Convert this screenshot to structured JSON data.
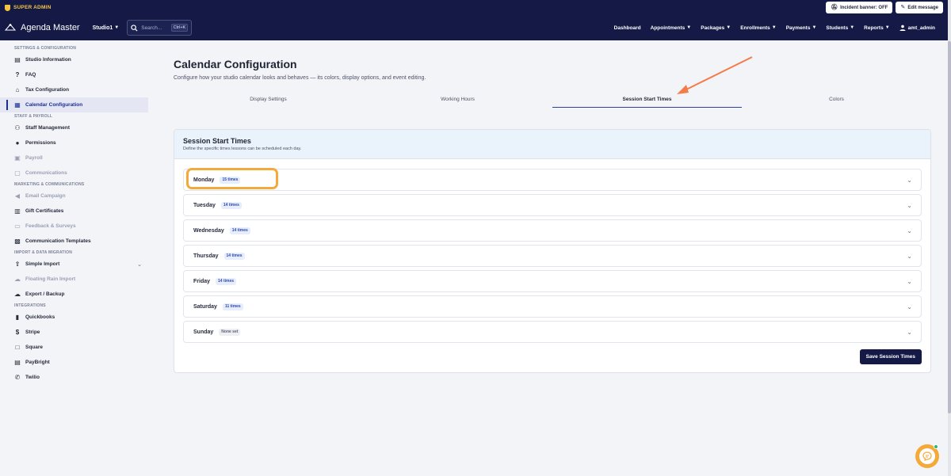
{
  "topbar": {
    "super_admin_label": "SUPER ADMIN",
    "incident_banner_label": "Incident banner: OFF",
    "edit_message_label": "Edit message"
  },
  "nav": {
    "brand": "Agenda Master",
    "studio": "Studio1",
    "search_placeholder": "Search...",
    "search_shortcut": "Ctrl+K",
    "menu": [
      {
        "label": "Dashboard",
        "has_caret": false
      },
      {
        "label": "Appointments",
        "has_caret": true
      },
      {
        "label": "Packages",
        "has_caret": true
      },
      {
        "label": "Enrollments",
        "has_caret": true
      },
      {
        "label": "Payments",
        "has_caret": true
      },
      {
        "label": "Students",
        "has_caret": true
      },
      {
        "label": "Reports",
        "has_caret": true
      }
    ],
    "user": "amt_admin"
  },
  "sidebar": {
    "sections": [
      {
        "title": "SETTINGS & CONFIGURATION",
        "items": [
          {
            "label": "Studio Information",
            "icon": "id-card-icon"
          },
          {
            "label": "FAQ",
            "icon": "help-circle-icon"
          },
          {
            "label": "Tax Configuration",
            "icon": "bank-icon"
          },
          {
            "label": "Calendar Configuration",
            "icon": "calendar-icon",
            "active": true
          }
        ]
      },
      {
        "title": "STAFF & PAYROLL",
        "items": [
          {
            "label": "Staff Management",
            "icon": "users-icon"
          },
          {
            "label": "Permissions",
            "icon": "user-shield-icon"
          },
          {
            "label": "Payroll",
            "icon": "money-icon",
            "muted": true
          },
          {
            "label": "Communications",
            "icon": "chat-icon",
            "muted": true
          }
        ]
      },
      {
        "title": "MARKETING & COMMUNICATIONS",
        "items": [
          {
            "label": "Email Campaign",
            "icon": "megaphone-icon",
            "muted": true
          },
          {
            "label": "Gift Certificates",
            "icon": "gift-icon"
          },
          {
            "label": "Feedback & Surveys",
            "icon": "feedback-icon",
            "muted": true
          },
          {
            "label": "Communication Templates",
            "icon": "templates-icon"
          }
        ]
      },
      {
        "title": "IMPORT & DATA MIGRATION",
        "items": [
          {
            "label": "Simple Import",
            "icon": "upload-icon",
            "chevron": true
          },
          {
            "label": "Floating Rain Import",
            "icon": "cloud-upload-icon",
            "muted": true
          },
          {
            "label": "Export / Backup",
            "icon": "cloud-download-icon"
          }
        ]
      },
      {
        "title": "INTEGRATIONS",
        "items": [
          {
            "label": "Quickbooks",
            "icon": "document-icon"
          },
          {
            "label": "Stripe",
            "icon": "stripe-icon"
          },
          {
            "label": "Square",
            "icon": "square-icon"
          },
          {
            "label": "PayBright",
            "icon": "printer-icon"
          },
          {
            "label": "Twilio",
            "icon": "phone-icon"
          }
        ]
      }
    ]
  },
  "main": {
    "title": "Calendar Configuration",
    "subtitle": "Configure how your studio calendar looks and behaves — its colors, display options, and event editing.",
    "tabs": [
      {
        "label": "Display Settings",
        "active": false
      },
      {
        "label": "Working Hours",
        "active": false
      },
      {
        "label": "Session Start Times",
        "active": true
      },
      {
        "label": "Colors",
        "active": false
      }
    ],
    "panel": {
      "title": "Session Start Times",
      "description": "Define the specific times lessons can be scheduled each day.",
      "days": [
        {
          "name": "Monday",
          "badge": "15 times",
          "highlighted": true
        },
        {
          "name": "Tuesday",
          "badge": "14 times"
        },
        {
          "name": "Wednesday",
          "badge": "14 times"
        },
        {
          "name": "Thursday",
          "badge": "14 times"
        },
        {
          "name": "Friday",
          "badge": "14 times"
        },
        {
          "name": "Saturday",
          "badge": "11 times"
        },
        {
          "name": "Sunday",
          "badge": "None set",
          "none": true
        }
      ],
      "save_label": "Save Session Times"
    }
  },
  "colors": {
    "navy": "#141a45",
    "accent_orange": "#f4a93b",
    "arrow_orange": "#f47c48",
    "active_blue": "#1c2f8f"
  }
}
